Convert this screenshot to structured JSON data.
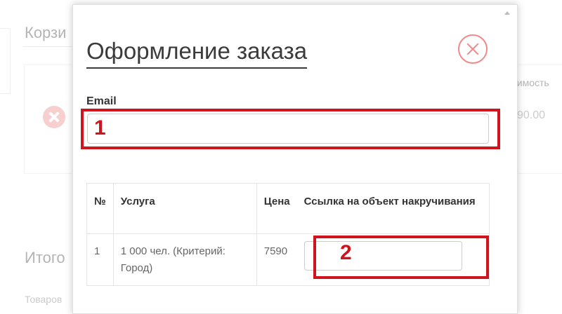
{
  "background": {
    "cart_title_partial": "Корзи",
    "cost_header_partial": "оимость",
    "cost_value_partial": "90.00",
    "totals_partial": "Итого",
    "goods_partial": "Товаров"
  },
  "modal": {
    "title": "Оформление заказа",
    "close_icon": "close-circle-icon",
    "email": {
      "label": "Email",
      "value": "",
      "placeholder": ""
    },
    "table": {
      "headers": {
        "num": "№",
        "service": "Услуга",
        "price": "Цена",
        "link": "Ссылка на объект накручивания"
      },
      "rows": [
        {
          "num": "1",
          "service": "1 000 чел. (Критерий: Город)",
          "price": "7590",
          "link_value": ""
        }
      ]
    }
  },
  "annotations": {
    "color": "#d0141d",
    "labels": [
      "1",
      "2"
    ]
  }
}
